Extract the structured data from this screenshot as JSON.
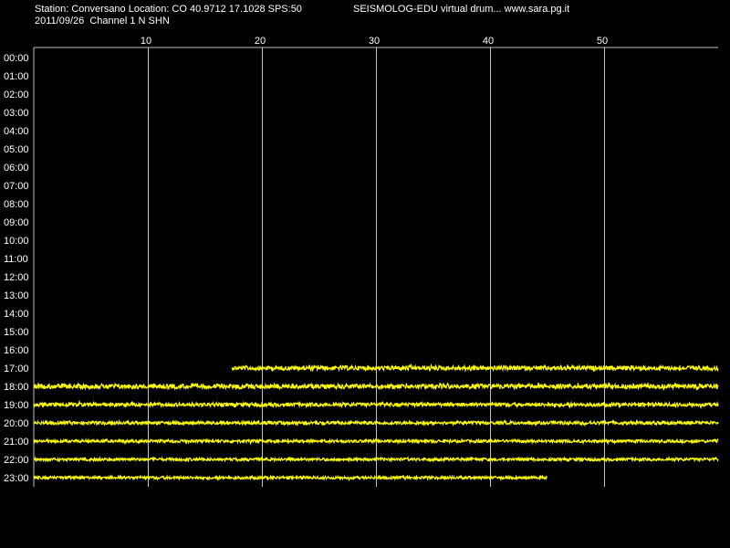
{
  "header": {
    "station_line": "Station: Conversano Location: CO 40.9712 17.1028 SPS:50",
    "date_line": "2011/09/26  Channel 1 N SHN",
    "brand": "SEISMOLOG-EDU virtual drum... www.sara.pg.it"
  },
  "colors": {
    "background": "#000000",
    "grid": "#c0c0c0",
    "trace": "#ffff00",
    "text": "#ffffff"
  },
  "chart_data": {
    "type": "line",
    "title": "",
    "xlabel": "",
    "ylabel": "",
    "xlim": [
      0,
      60
    ],
    "x_ticks": [
      10,
      20,
      30,
      40,
      50
    ],
    "hours": [
      "00:00",
      "01:00",
      "02:00",
      "03:00",
      "04:00",
      "05:00",
      "06:00",
      "07:00",
      "08:00",
      "09:00",
      "10:00",
      "11:00",
      "12:00",
      "13:00",
      "14:00",
      "15:00",
      "16:00",
      "17:00",
      "18:00",
      "19:00",
      "20:00",
      "21:00",
      "22:00",
      "23:00"
    ],
    "grid": true,
    "series": [
      {
        "hour": "17:00",
        "start_min": 17.4,
        "end_min": 60,
        "amplitude": 2.4
      },
      {
        "hour": "18:00",
        "start_min": 0,
        "end_min": 60,
        "amplitude": 2.6
      },
      {
        "hour": "19:00",
        "start_min": 0,
        "end_min": 60,
        "amplitude": 2.0
      },
      {
        "hour": "20:00",
        "start_min": 0,
        "end_min": 60,
        "amplitude": 1.8
      },
      {
        "hour": "21:00",
        "start_min": 0,
        "end_min": 60,
        "amplitude": 1.6
      },
      {
        "hour": "22:00",
        "start_min": 0,
        "end_min": 60,
        "amplitude": 1.6
      },
      {
        "hour": "23:00",
        "start_min": 0,
        "end_min": 45,
        "amplitude": 1.6
      }
    ]
  }
}
